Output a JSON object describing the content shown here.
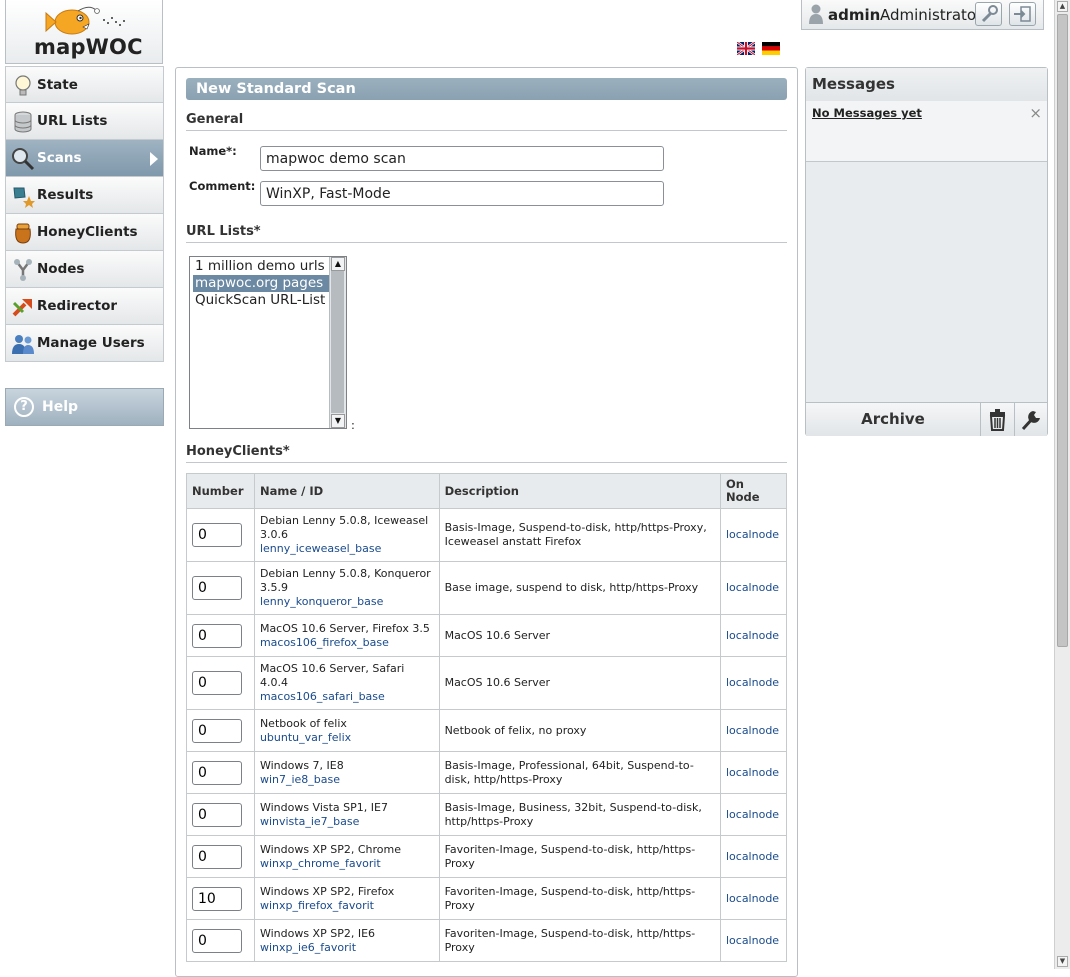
{
  "app": {
    "logo_text": "mapWOC"
  },
  "user": {
    "name": "admin",
    "role": "Administrator"
  },
  "nav": {
    "items": [
      {
        "label": "State",
        "icon": "bulb-icon"
      },
      {
        "label": "URL Lists",
        "icon": "database-icon"
      },
      {
        "label": "Scans",
        "icon": "magnifier-icon",
        "active": true
      },
      {
        "label": "Results",
        "icon": "results-icon"
      },
      {
        "label": "HoneyClients",
        "icon": "honeypot-icon"
      },
      {
        "label": "Nodes",
        "icon": "nodes-icon"
      },
      {
        "label": "Redirector",
        "icon": "redirector-icon"
      },
      {
        "label": "Manage Users",
        "icon": "users-icon"
      }
    ],
    "help_label": "Help"
  },
  "form": {
    "title": "New Standard Scan",
    "general_heading": "General",
    "name_label": "Name*:",
    "name_value": "mapwoc demo scan",
    "comment_label": "Comment:",
    "comment_value": "WinXP, Fast-Mode",
    "urllists_heading": "URL Lists*",
    "urllists": [
      "1 million demo urls",
      "mapwoc.org pages",
      "QuickScan URL-List"
    ],
    "urllists_selected": "mapwoc.org pages",
    "urllists_after": ":",
    "honeyclients_heading": "HoneyClients*",
    "table_headers": [
      "Number",
      "Name / ID",
      "Description",
      "On Node"
    ],
    "rows": [
      {
        "number": "0",
        "name": "Debian Lenny 5.0.8, Iceweasel 3.0.6",
        "id": "lenny_iceweasel_base",
        "description": "Basis-Image, Suspend-to-disk, http/https-Proxy, Iceweasel anstatt Firefox",
        "node": "localnode"
      },
      {
        "number": "0",
        "name": "Debian Lenny 5.0.8, Konqueror 3.5.9",
        "id": "lenny_konqueror_base",
        "description": "Base image, suspend to disk, http/https-Proxy",
        "node": "localnode"
      },
      {
        "number": "0",
        "name": "MacOS 10.6 Server, Firefox 3.5",
        "id": "macos106_firefox_base",
        "description": "MacOS 10.6 Server",
        "node": "localnode"
      },
      {
        "number": "0",
        "name": "MacOS 10.6 Server, Safari 4.0.4",
        "id": "macos106_safari_base",
        "description": "MacOS 10.6 Server",
        "node": "localnode"
      },
      {
        "number": "0",
        "name": "Netbook of felix",
        "id": "ubuntu_var_felix",
        "description": "Netbook of felix, no proxy",
        "node": "localnode"
      },
      {
        "number": "0",
        "name": "Windows 7, IE8",
        "id": "win7_ie8_base",
        "description": "Basis-Image, Professional, 64bit, Suspend-to-disk, http/https-Proxy",
        "node": "localnode"
      },
      {
        "number": "0",
        "name": "Windows Vista SP1, IE7",
        "id": "winvista_ie7_base",
        "description": "Basis-Image, Business, 32bit, Suspend-to-disk, http/https-Proxy",
        "node": "localnode"
      },
      {
        "number": "0",
        "name": "Windows XP SP2, Chrome",
        "id": "winxp_chrome_favorit",
        "description": "Favoriten-Image, Suspend-to-disk, http/https-Proxy",
        "node": "localnode"
      },
      {
        "number": "10",
        "name": "Windows XP SP2, Firefox",
        "id": "winxp_firefox_favorit",
        "description": "Favoriten-Image, Suspend-to-disk, http/https-Proxy",
        "node": "localnode"
      },
      {
        "number": "0",
        "name": "Windows XP SP2, IE6",
        "id": "winxp_ie6_favorit",
        "description": "Favoriten-Image, Suspend-to-disk, http/https-Proxy",
        "node": "localnode"
      }
    ]
  },
  "messages": {
    "title": "Messages",
    "empty_text": "No Messages yet",
    "close_glyph": "×",
    "archive_label": "Archive"
  },
  "colors": {
    "accent": "#8aa1b1",
    "link": "#1a4b8c",
    "selected": "#6c89a3"
  }
}
